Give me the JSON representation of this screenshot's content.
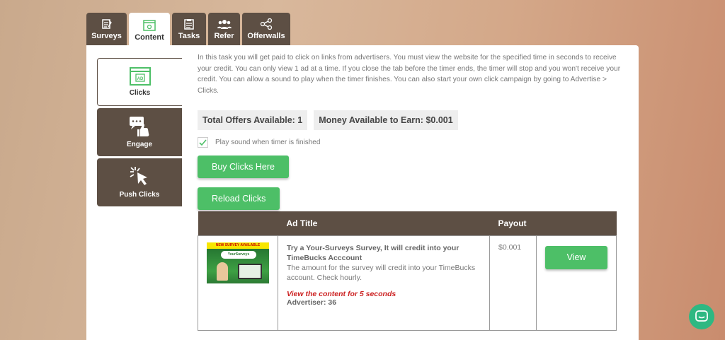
{
  "tabs": [
    {
      "label": "Surveys",
      "icon": "survey-icon"
    },
    {
      "label": "Content",
      "icon": "content-icon"
    },
    {
      "label": "Tasks",
      "icon": "tasks-icon"
    },
    {
      "label": "Refer",
      "icon": "refer-icon"
    },
    {
      "label": "Offerwalls",
      "icon": "share-icon"
    }
  ],
  "sidebar": [
    {
      "label": "Clicks",
      "icon": "ad-icon",
      "icon_text": "AD"
    },
    {
      "label": "Engage",
      "icon": "engage-icon"
    },
    {
      "label": "Push Clicks",
      "icon": "cursor-click-icon"
    }
  ],
  "description": "In this task you will get paid to click on links from advertisers. You must view the website for the specified time in seconds to receive your credit. You can only view 1 ad at a time. If you close the tab before the timer ends, the timer will stop and you won't receive your credit. You can allow a sound to play when the timer finishes. You can also start your own click campaign by going to Advertise > Clicks.",
  "stats": {
    "total_offers": "Total Offers Available: 1",
    "money": "Money Available to Earn: $0.001"
  },
  "sound_label": "Play sound when timer is finished",
  "buttons": {
    "buy": "Buy Clicks Here",
    "reload": "Reload Clicks",
    "view": "View"
  },
  "table": {
    "headers": [
      "",
      "Ad Title",
      "Payout",
      ""
    ],
    "rows": [
      {
        "thumb_banner": "NEW SURVEY AVAILABLE",
        "thumb_brand": "YourSurveys",
        "title": "Try a Your-Surveys Survey, It will credit into your TimeBucks Acccount",
        "body": "The amount for the survey will credit into your TimeBucks account. Check hourly.",
        "time": "View the content for 5 seconds",
        "advertiser": "Advertiser: 36",
        "payout": "$0.001"
      }
    ]
  },
  "colors": {
    "brown": "#5d4f44",
    "green": "#4dbf67",
    "chat": "#2eb882"
  }
}
